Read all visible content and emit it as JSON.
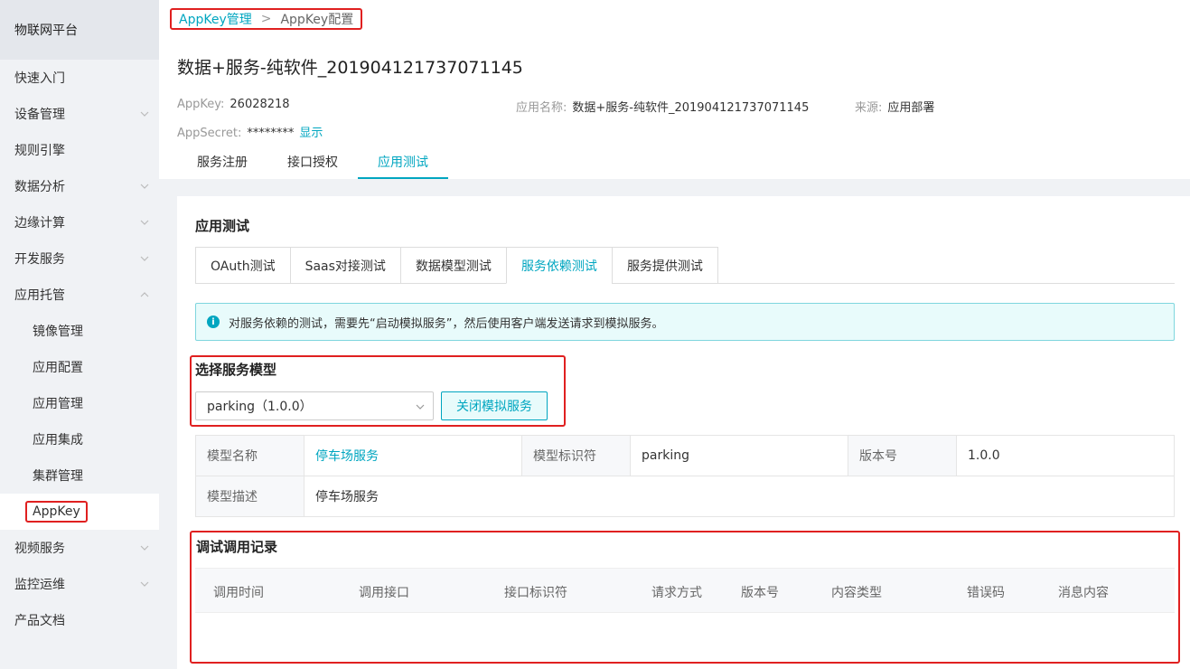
{
  "sidebar": {
    "brand": "物联网平台",
    "items": [
      {
        "label": "快速入门",
        "has_chevron": false
      },
      {
        "label": "设备管理",
        "has_chevron": true,
        "chevron": "down"
      },
      {
        "label": "规则引擎",
        "has_chevron": false
      },
      {
        "label": "数据分析",
        "has_chevron": true,
        "chevron": "down"
      },
      {
        "label": "边缘计算",
        "has_chevron": true,
        "chevron": "down"
      },
      {
        "label": "开发服务",
        "has_chevron": true,
        "chevron": "down"
      },
      {
        "label": "应用托管",
        "has_chevron": true,
        "chevron": "up"
      }
    ],
    "sub_items": [
      "镜像管理",
      "应用配置",
      "应用管理",
      "应用集成",
      "集群管理",
      "AppKey"
    ],
    "bottom_items": [
      {
        "label": "视频服务",
        "has_chevron": true
      },
      {
        "label": "监控运维",
        "has_chevron": true
      },
      {
        "label": "产品文档",
        "has_chevron": false
      }
    ]
  },
  "breadcrumb": {
    "link": "AppKey管理",
    "separator": ">",
    "current": "AppKey配置"
  },
  "page_title": "数据+服务-纯软件_201904121737071145",
  "meta": {
    "appkey_label": "AppKey:",
    "appkey_value": "26028218",
    "app_name_label": "应用名称:",
    "app_name_value": "数据+服务-纯软件_201904121737071145",
    "source_label": "来源:",
    "source_value": "应用部署",
    "secret_label": "AppSecret:",
    "secret_value": "********",
    "show_link": "显示"
  },
  "top_tabs": [
    "服务注册",
    "接口授权",
    "应用测试"
  ],
  "card": {
    "title": "应用测试",
    "sub_tabs": [
      "OAuth测试",
      "Saas对接测试",
      "数据模型测试",
      "服务依赖测试",
      "服务提供测试"
    ],
    "info_text": "对服务依赖的测试，需要先“启动模拟服务”，然后使用客户端发送请求到模拟服务。",
    "select_title": "选择服务模型",
    "select_value": "parking（1.0.0）",
    "stop_button": "关闭模拟服务",
    "model": {
      "name_label": "模型名称",
      "name_value": "停车场服务",
      "id_label": "模型标识符",
      "id_value": "parking",
      "version_label": "版本号",
      "version_value": "1.0.0",
      "desc_label": "模型描述",
      "desc_value": "停车场服务"
    },
    "records_title": "调试调用记录",
    "records_columns": [
      "调用时间",
      "调用接口",
      "接口标识符",
      "请求方式",
      "版本号",
      "内容类型",
      "错误码",
      "消息内容"
    ]
  },
  "colors": {
    "accent": "#00a6c0",
    "highlight": "#e02020"
  }
}
